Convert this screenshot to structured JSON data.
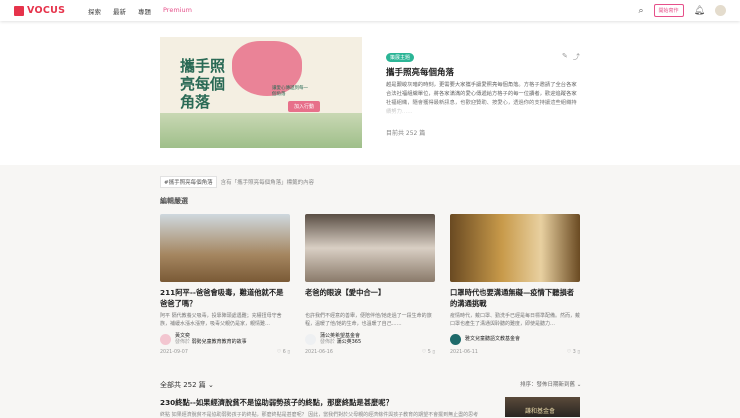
{
  "header": {
    "logo": "VOCUS",
    "nav": [
      "探索",
      "最新",
      "專題",
      "Premium"
    ],
    "start_writing": "開始寫作"
  },
  "hero": {
    "image_title": "攜手照亮每個角落",
    "image_sub": "讓愛心傳遞到每一個角落",
    "image_button": "加入行動",
    "badge": "策展主題",
    "title": "攜手照亮每個角落",
    "description": "越是艱峻灰暗的時刻，更需要大家攜手讓愛照亮每個角落。方格子邀請了全台各家合法社福組織單位，將各家滿滿的愛心傳遞給方格子的每一位讀者，歡迎追蹤各家社福組織，隨會獲得最新訊息，也歡迎贊助、按愛心，透過你的支持讓這些組織持續努力……",
    "count": "目前共 252 篇"
  },
  "tagbar": {
    "tag": "#攜手照亮每個角落",
    "text": "含有「攜手照亮每個角落」標籤的內容"
  },
  "section_title": "編輯嚴選",
  "cards": [
    {
      "title": "211阿平--爸爸會吸毒，難道他就不是爸爸了嗎？",
      "desc": "阿平 隔代教養父吸毒，投靠陣頭處遇難；充權扭母守舍族，補緩水漲水漲穿，吸毒父親仍是家，親情難…",
      "author": "黃文奕",
      "role": "發佈於",
      "pub": "弱勢兒童教育教育的故事",
      "date": "2021-09-07",
      "likes": "6"
    },
    {
      "title": "老爸的眼淚【愛中合一】",
      "desc": "也許我們不經意的善舉，便陪伴他/她走過了一段生命的旅程，溫暖了他/她的生命，也溫暖了自己……",
      "author": "蒲公英希望基金會",
      "role": "發佈於",
      "pub": "蒲公英365",
      "date": "2021-06-16",
      "likes": "5"
    },
    {
      "title": "口罩時代也要溝通無礙—疫情下聽損者的溝通挑戰",
      "desc": "疫情時代，戴口罩、勤洗手已經是每日標準配備。然而，戴口罩也產生了溝通與聆聽的難度，即使是聽力…",
      "author": "雅文兒童聽語文教基金會",
      "role": "",
      "pub": "",
      "date": "2021-06-11",
      "likes": "3"
    }
  ],
  "list": {
    "total": "全部共 252 篇",
    "sort": "排序：發佈日期新到舊",
    "items": [
      {
        "title": "230終點--如果經濟脫貧不是協助弱勢孩子的終點，那麼終點是甚麼呢？",
        "desc": "終點 如果經濟脫貧不是協助弱勢孩子的終點，那麼終點是甚麼呢？ 因此，當我們對於父母親的經濟條件與孩子教育的期望不會擺到無止盡的思考",
        "thumb": "謙和基金會"
      }
    ]
  }
}
